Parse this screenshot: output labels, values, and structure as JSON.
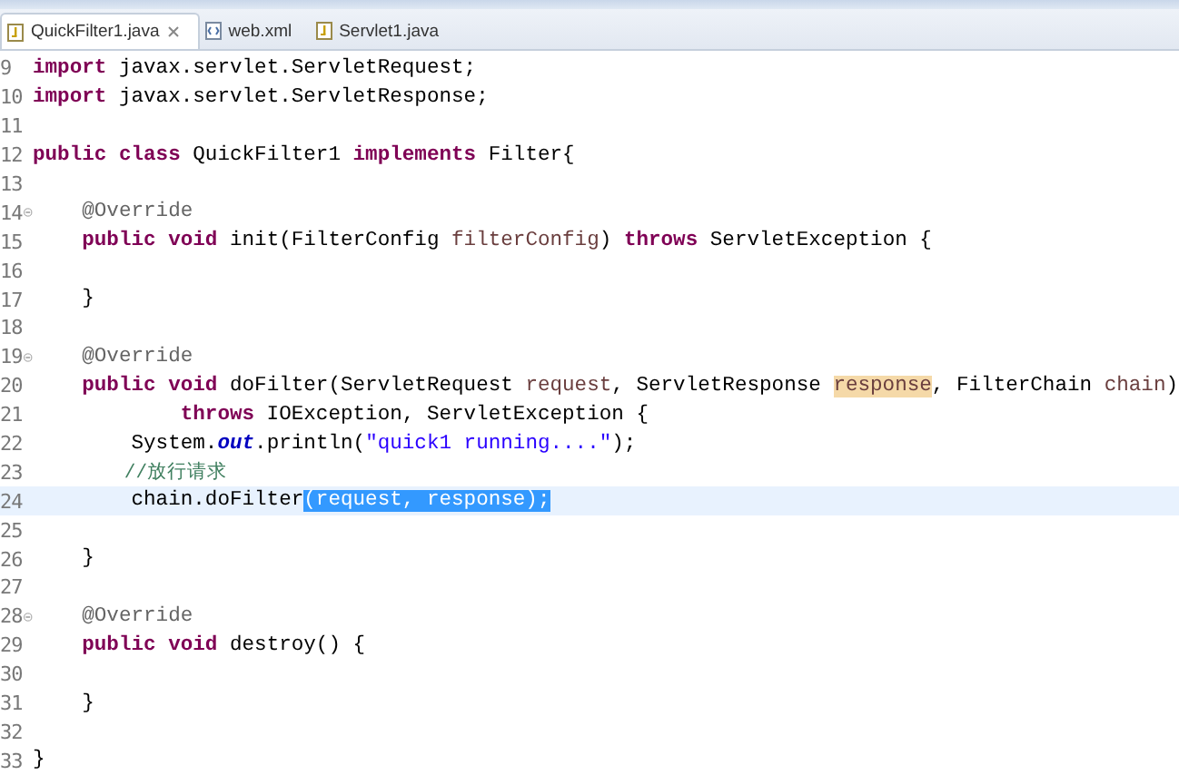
{
  "tabs": [
    {
      "label": "QuickFilter1.java",
      "selected": true,
      "kind": "java",
      "closable": true
    },
    {
      "label": "web.xml",
      "selected": false,
      "kind": "xml",
      "closable": false
    },
    {
      "label": "Servlet1.java",
      "selected": false,
      "kind": "java",
      "closable": false
    }
  ],
  "editor": {
    "lines": [
      {
        "number": "9",
        "foldable": false,
        "current": false,
        "tokens": [
          {
            "kind": "keyword",
            "text": "import"
          },
          {
            "kind": "plain",
            "text": " javax.servlet.ServletRequest;"
          }
        ]
      },
      {
        "number": "10",
        "foldable": false,
        "current": false,
        "tokens": [
          {
            "kind": "keyword",
            "text": "import"
          },
          {
            "kind": "plain",
            "text": " javax.servlet.ServletResponse;"
          }
        ]
      },
      {
        "number": "11",
        "foldable": false,
        "current": false
      },
      {
        "number": "12",
        "foldable": false,
        "current": false,
        "tokens": [
          {
            "kind": "keyword",
            "text": "public class"
          },
          {
            "kind": "plain",
            "text": " QuickFilter1 "
          },
          {
            "kind": "keyword",
            "text": "implements"
          },
          {
            "kind": "plain",
            "text": " Filter{"
          }
        ]
      },
      {
        "number": "13",
        "foldable": false,
        "current": false
      },
      {
        "number": "14",
        "foldable": true,
        "current": false,
        "tokens": [
          {
            "kind": "annotation",
            "text": "    @Override"
          }
        ]
      },
      {
        "number": "15",
        "foldable": false,
        "current": false,
        "tokens": [
          {
            "kind": "keyword",
            "text": "    public void"
          },
          {
            "kind": "plain",
            "text": " init(FilterConfig "
          },
          {
            "kind": "param",
            "text": "filterConfig"
          },
          {
            "kind": "plain",
            "text": ") "
          },
          {
            "kind": "keyword",
            "text": "throws"
          },
          {
            "kind": "plain",
            "text": " ServletException {"
          }
        ]
      },
      {
        "number": "16",
        "foldable": false,
        "current": false
      },
      {
        "number": "17",
        "foldable": false,
        "current": false,
        "tokens": [
          {
            "kind": "plain",
            "text": "    }"
          }
        ]
      },
      {
        "number": "18",
        "foldable": false,
        "current": false
      },
      {
        "number": "19",
        "foldable": true,
        "current": false,
        "tokens": [
          {
            "kind": "annotation",
            "text": "    @Override"
          }
        ]
      },
      {
        "number": "20",
        "foldable": false,
        "current": false,
        "tokens": [
          {
            "kind": "keyword",
            "text": "    public void"
          },
          {
            "kind": "plain",
            "text": " doFilter(ServletRequest "
          },
          {
            "kind": "param",
            "text": "request"
          },
          {
            "kind": "plain",
            "text": ", ServletResponse "
          },
          {
            "kind": "occurrence",
            "text": "response"
          },
          {
            "kind": "plain",
            "text": ", FilterChain "
          },
          {
            "kind": "param",
            "text": "chain"
          },
          {
            "kind": "plain",
            "text": ")"
          }
        ]
      },
      {
        "number": "21",
        "foldable": false,
        "current": false,
        "tokens": [
          {
            "kind": "keyword",
            "text": "            throws"
          },
          {
            "kind": "plain",
            "text": " IOException, ServletException {"
          }
        ]
      },
      {
        "number": "22",
        "foldable": false,
        "current": false,
        "tokens": [
          {
            "kind": "plain",
            "text": "        System."
          },
          {
            "kind": "static",
            "text": "out"
          },
          {
            "kind": "plain",
            "text": ".println("
          },
          {
            "kind": "string",
            "text": "\"quick1 running....\""
          },
          {
            "kind": "plain",
            "text": ");"
          }
        ]
      },
      {
        "number": "23",
        "foldable": false,
        "current": false,
        "tokens": [
          {
            "kind": "comment",
            "text": "        //放行请求"
          }
        ]
      },
      {
        "number": "24",
        "foldable": false,
        "current": true,
        "tokens": [
          {
            "kind": "plain",
            "text": "        chain.doFilter"
          },
          {
            "kind": "selection",
            "text": "(request, response);"
          }
        ]
      },
      {
        "number": "25",
        "foldable": false,
        "current": false
      },
      {
        "number": "26",
        "foldable": false,
        "current": false,
        "tokens": [
          {
            "kind": "plain",
            "text": "    }"
          }
        ]
      },
      {
        "number": "27",
        "foldable": false,
        "current": false
      },
      {
        "number": "28",
        "foldable": true,
        "current": false,
        "tokens": [
          {
            "kind": "annotation",
            "text": "    @Override"
          }
        ]
      },
      {
        "number": "29",
        "foldable": false,
        "current": false,
        "tokens": [
          {
            "kind": "keyword",
            "text": "    public void"
          },
          {
            "kind": "plain",
            "text": " destroy() {"
          }
        ]
      },
      {
        "number": "30",
        "foldable": false,
        "current": false
      },
      {
        "number": "31",
        "foldable": false,
        "current": false,
        "tokens": [
          {
            "kind": "plain",
            "text": "    }"
          }
        ]
      },
      {
        "number": "32",
        "foldable": false,
        "current": false
      },
      {
        "number": "33",
        "foldable": false,
        "current": false,
        "tokens": [
          {
            "kind": "plain",
            "text": "}"
          }
        ]
      }
    ]
  }
}
